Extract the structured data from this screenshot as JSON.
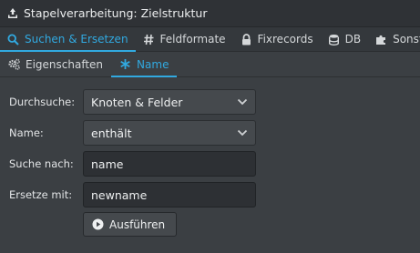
{
  "window": {
    "title": "Stapelverarbeitung: Zielstruktur",
    "title_icon": "recycle-icon"
  },
  "main_tabs": [
    {
      "label": "Suchen & Ersetzen",
      "icon": "search-icon",
      "active": true
    },
    {
      "label": "Feldformate",
      "icon": "hash-icon",
      "active": false
    },
    {
      "label": "Fixrecords",
      "icon": "lock-icon",
      "active": false
    },
    {
      "label": "DB",
      "icon": "database-icon",
      "active": false
    },
    {
      "label": "Sonstige",
      "icon": "puzzle-icon",
      "active": false
    }
  ],
  "sub_tabs": [
    {
      "label": "Eigenschaften",
      "icon": "gears-icon",
      "active": false
    },
    {
      "label": "Name",
      "icon": "asterisk-icon",
      "active": true
    }
  ],
  "form": {
    "search_in": {
      "label": "Durchsuche:",
      "value": "Knoten & Felder"
    },
    "name_mode": {
      "label": "Name:",
      "value": "enthält"
    },
    "search_for": {
      "label": "Suche nach:",
      "value": "name"
    },
    "replace_with": {
      "label": "Ersetze mit:",
      "value": "newname"
    }
  },
  "run_button": {
    "label": "Ausführen",
    "icon": "play-circle-icon"
  },
  "colors": {
    "accent": "#31a9e0",
    "background": "#3b3f43",
    "input_bg": "#2d3034"
  }
}
